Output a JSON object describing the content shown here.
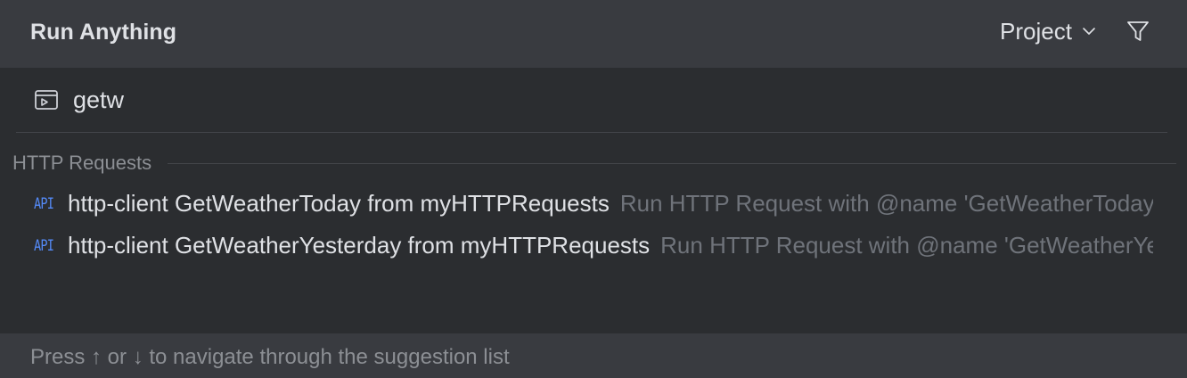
{
  "header": {
    "title": "Run Anything",
    "scope_label": "Project",
    "chevron_icon": "chevron-down-icon",
    "filter_icon": "filter-icon"
  },
  "search": {
    "icon": "run-configuration-icon",
    "value": "getw"
  },
  "groups": [
    {
      "label": "HTTP Requests",
      "items": [
        {
          "icon_text": "API",
          "name": "http-client GetWeatherToday from myHTTPRequests",
          "description": "Run HTTP Request with @name 'GetWeatherToday'"
        },
        {
          "icon_text": "API",
          "name": "http-client GetWeatherYesterday from myHTTPRequests",
          "description": "Run HTTP Request with @name 'GetWeatherYesterday'"
        }
      ]
    }
  ],
  "footer": {
    "hint": "Press ↑ or ↓ to navigate through the suggestion list"
  },
  "colors": {
    "header_bg": "#393b40",
    "body_bg": "#2b2d30",
    "text": "#dfe1e5",
    "muted": "#6f737a",
    "api_accent": "#548af7"
  }
}
